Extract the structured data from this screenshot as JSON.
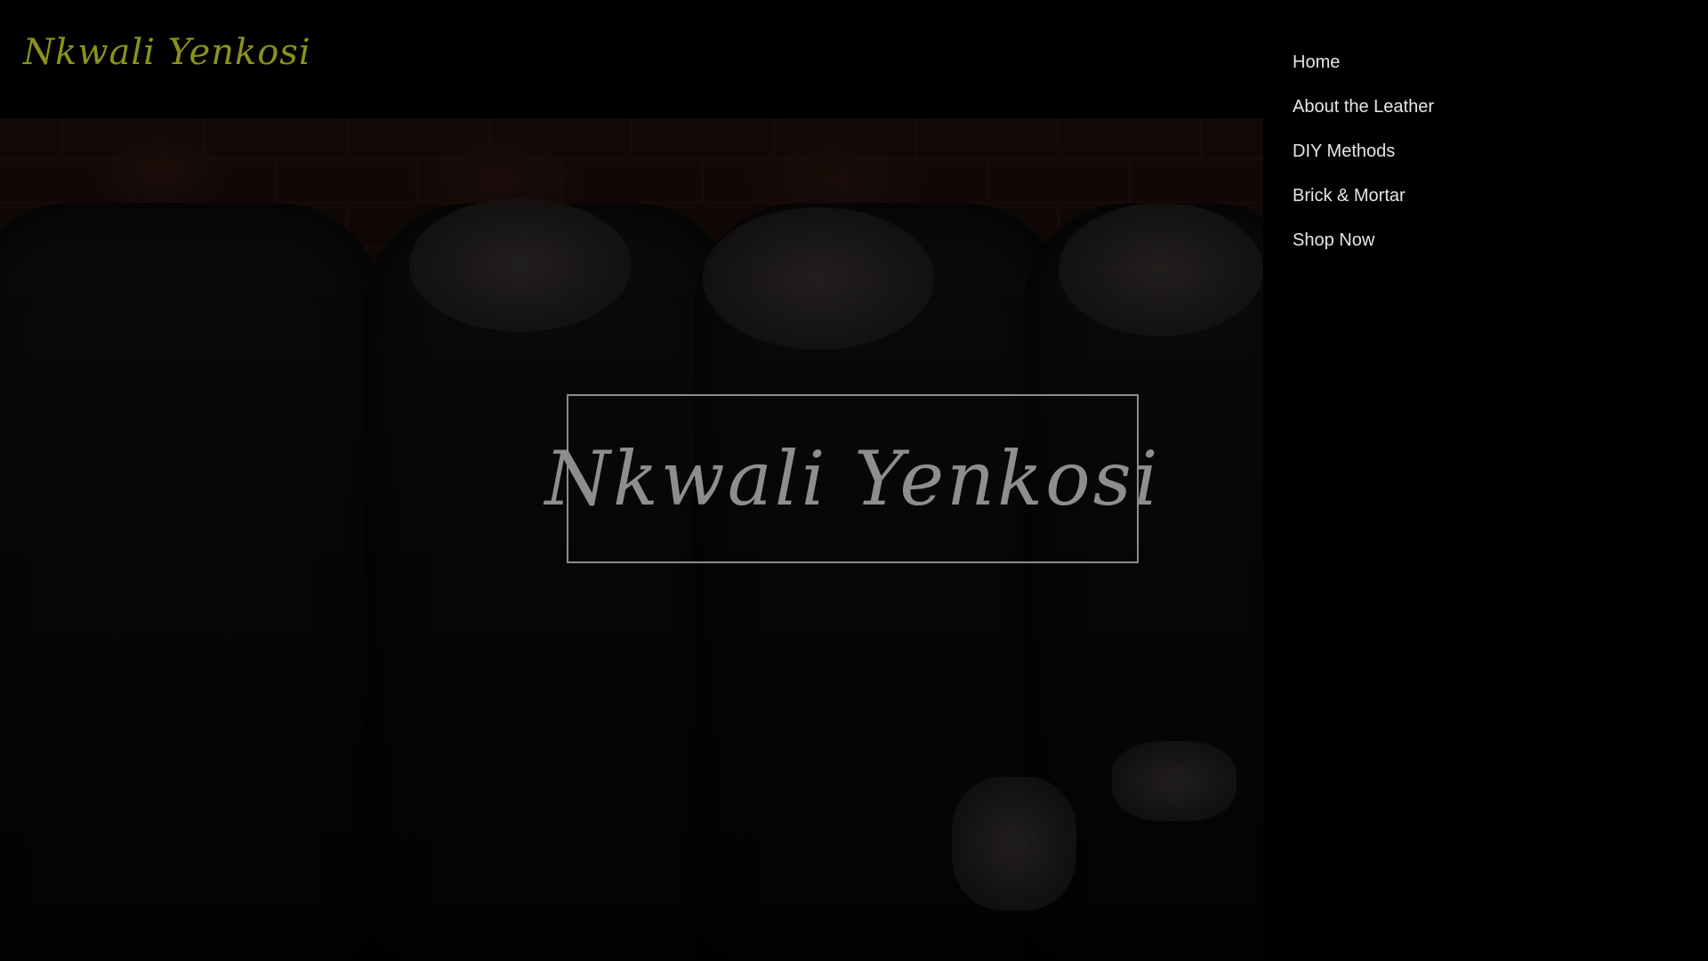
{
  "site": {
    "logo_text": "Nkwali Yenkosi",
    "logo_color": "#8a9319"
  },
  "hero": {
    "title": "Nkwali Yenkosi",
    "image_icon": "leather-jackets-photo"
  },
  "nav": {
    "items": [
      {
        "label": "Home"
      },
      {
        "label": "About the Leather"
      },
      {
        "label": "DIY Methods"
      },
      {
        "label": "Brick & Mortar"
      },
      {
        "label": "Shop Now"
      }
    ]
  },
  "colors": {
    "background": "#000000",
    "nav_text": "#e6e6e6",
    "title_text": "#8e8e8e",
    "progress_accent": "#1fa52a"
  }
}
